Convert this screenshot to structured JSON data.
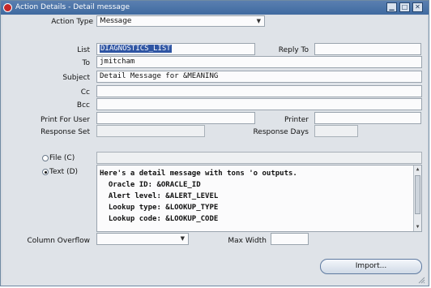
{
  "window": {
    "title": "Action Details - Detail message"
  },
  "action_type": {
    "label": "Action Type",
    "value": "Message"
  },
  "list": {
    "label": "List",
    "value": "DIAGNOSTICS_LIST"
  },
  "reply_to": {
    "label": "Reply To",
    "value": ""
  },
  "to": {
    "label": "To",
    "value": "jmitcham"
  },
  "subject": {
    "label": "Subject",
    "value": "Detail Message for &MEANING"
  },
  "cc": {
    "label": "Cc",
    "value": ""
  },
  "bcc": {
    "label": "Bcc",
    "value": ""
  },
  "print_for_user": {
    "label": "Print For User",
    "value": ""
  },
  "printer": {
    "label": "Printer",
    "value": ""
  },
  "response_set": {
    "label": "Response Set",
    "value": ""
  },
  "response_days": {
    "label": "Response Days",
    "value": ""
  },
  "file_option": {
    "label": "File (C)",
    "selected": false,
    "value": ""
  },
  "text_option": {
    "label": "Text (D)",
    "selected": true,
    "lines": [
      "Here's a detail message with tons 'o outputs.",
      "  Oracle ID: &ORACLE_ID",
      "  Alert level: &ALERT_LEVEL",
      "  Lookup type: &LOOKUP_TYPE",
      "  Lookup code: &LOOKUP_CODE"
    ]
  },
  "column_overflow": {
    "label": "Column Overflow",
    "value": ""
  },
  "max_width": {
    "label": "Max Width",
    "value": ""
  },
  "import_button": {
    "label": "Import..."
  }
}
